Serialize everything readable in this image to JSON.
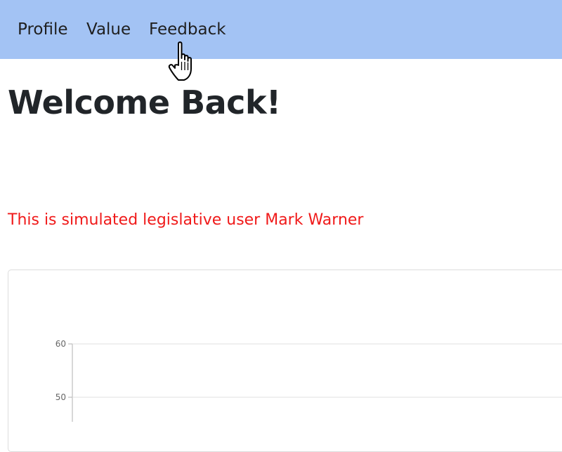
{
  "nav": {
    "items": [
      {
        "label": "Profile"
      },
      {
        "label": "Value"
      },
      {
        "label": "Feedback"
      }
    ],
    "background": "#a3c3f4"
  },
  "cursor_icon": "hand-pointer",
  "main": {
    "title": "Welcome Back!",
    "notice": "This is simulated legislative user Mark Warner",
    "notice_color": "#f01a1a"
  },
  "chart_data": {
    "type": "line",
    "title": "",
    "xlabel": "",
    "ylabel": "",
    "y_ticks_visible": [
      60,
      50
    ],
    "grid": true,
    "series": []
  }
}
